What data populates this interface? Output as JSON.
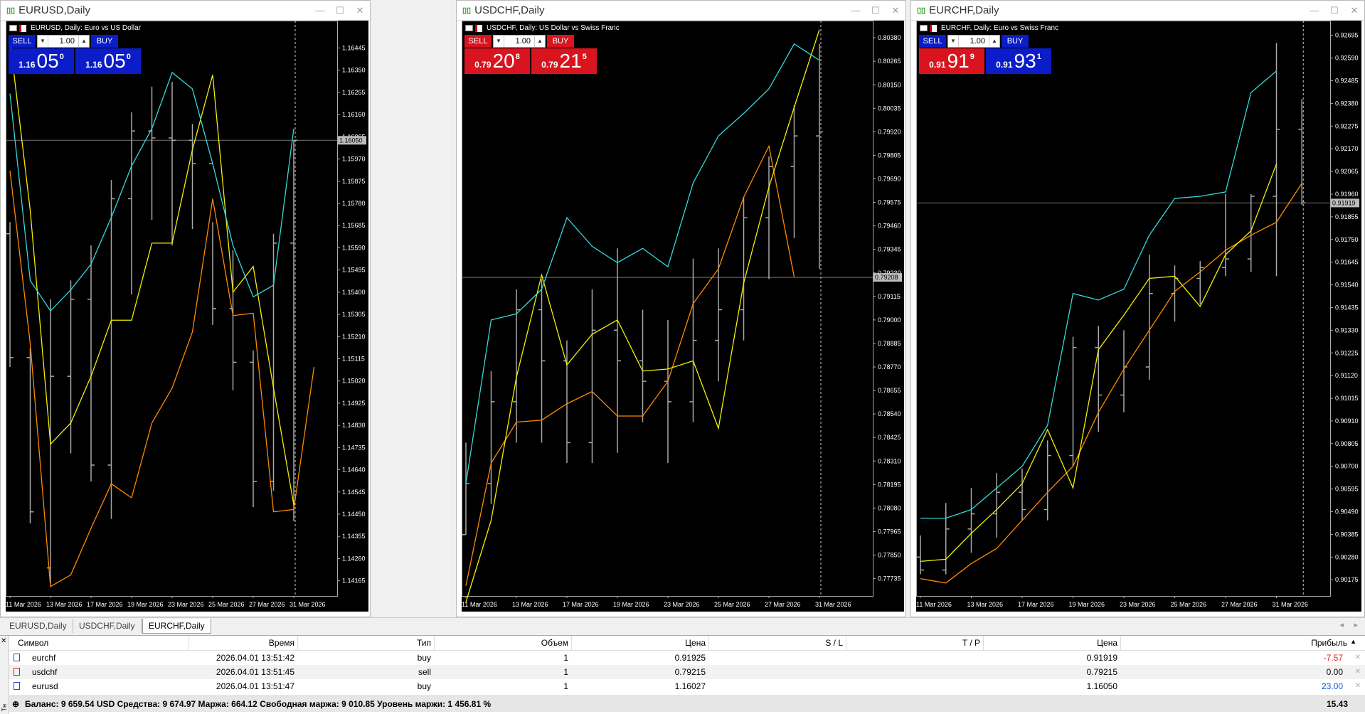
{
  "colors": {
    "bull": "#0b1cc9",
    "bear": "#d9141e",
    "cyan": "#33dada",
    "yellow": "#f5f000",
    "orange": "#ff8a00",
    "bar": "#a8a8a8"
  },
  "charts": [
    {
      "title": "EURUSD,Daily",
      "header": "EURUSD, Daily:  Euro vs US Dollar",
      "sell_label": "SELL",
      "buy_label": "BUY",
      "volume": "1.00",
      "sell_price": {
        "small": "1.16",
        "big": "05",
        "sup": "0"
      },
      "buy_price": {
        "small": "1.16",
        "big": "05",
        "sup": "0"
      },
      "price_ticks": [
        "1.16445",
        "1.16350",
        "1.16255",
        "1.16160",
        "1.16065",
        "1.15970",
        "1.15875",
        "1.15780",
        "1.15685",
        "1.15590",
        "1.15495",
        "1.15400",
        "1.15305",
        "1.15210",
        "1.15115",
        "1.15020",
        "1.14925",
        "1.14830",
        "1.14735",
        "1.14640",
        "1.14545",
        "1.14450",
        "1.14355",
        "1.14260",
        "1.14165"
      ],
      "current_price": "1.16050",
      "date_ticks": [
        "11 Mar 2026",
        "13 Mar 2026",
        "17 Mar 2026",
        "19 Mar 2026",
        "23 Mar 2026",
        "25 Mar 2026",
        "27 Mar 2026",
        "31 Mar 2026"
      ]
    },
    {
      "title": "USDCHF,Daily",
      "header": "USDCHF, Daily:  US Dollar vs Swiss Franc",
      "sell_label": "SELL",
      "buy_label": "BUY",
      "volume": "1.00",
      "sell_price": {
        "small": "0.79",
        "big": "20",
        "sup": "8"
      },
      "buy_price": {
        "small": "0.79",
        "big": "21",
        "sup": "5"
      },
      "price_ticks": [
        "0.80380",
        "0.80265",
        "0.80150",
        "0.80035",
        "0.79920",
        "0.79805",
        "0.79690",
        "0.79575",
        "0.79460",
        "0.79345",
        "0.79230",
        "0.79115",
        "0.79000",
        "0.78885",
        "0.78770",
        "0.78655",
        "0.78540",
        "0.78425",
        "0.78310",
        "0.78195",
        "0.78080",
        "0.77965",
        "0.77850",
        "0.77735"
      ],
      "current_price": "0.79208",
      "date_ticks": [
        "11 Mar 2026",
        "13 Mar 2026",
        "17 Mar 2026",
        "19 Mar 2026",
        "23 Mar 2026",
        "25 Mar 2026",
        "27 Mar 2026",
        "31 Mar 2026"
      ]
    },
    {
      "title": "EURCHF,Daily",
      "header": "EURCHF, Daily:  Euro vs Swiss Franc",
      "sell_label": "SELL",
      "buy_label": "BUY",
      "volume": "1.00",
      "sell_price": {
        "small": "0.91",
        "big": "91",
        "sup": "9"
      },
      "buy_price": {
        "small": "0.91",
        "big": "93",
        "sup": "1"
      },
      "price_ticks": [
        "0.92695",
        "0.92590",
        "0.92485",
        "0.92380",
        "0.92275",
        "0.92170",
        "0.92065",
        "0.91960",
        "0.91855",
        "0.91750",
        "0.91645",
        "0.91540",
        "0.91435",
        "0.91330",
        "0.91225",
        "0.91120",
        "0.91015",
        "0.90910",
        "0.90805",
        "0.90700",
        "0.90595",
        "0.90490",
        "0.90385",
        "0.90280",
        "0.90175"
      ],
      "current_price": "0.91919",
      "date_ticks": [
        "11 Mar 2026",
        "13 Mar 2026",
        "17 Mar 2026",
        "19 Mar 2026",
        "23 Mar 2026",
        "25 Mar 2026",
        "27 Mar 2026",
        "31 Mar 2026"
      ]
    }
  ],
  "tabs": [
    "EURUSD,Daily",
    "USDCHF,Daily",
    "EURCHF,Daily"
  ],
  "terminal": {
    "columns": [
      "Символ",
      "Время",
      "Тип",
      "Объем",
      "Цена",
      "S / L",
      "T / P",
      "Цена",
      "Прибыль"
    ],
    "rows": [
      {
        "symbol": "eurchf",
        "time": "2026.04.01 13:51:42",
        "type": "buy",
        "volume": "1",
        "price": "0.91925",
        "sl": "",
        "tp": "",
        "cur": "0.91919",
        "profit": "-7.57",
        "pcolor": "#e02020"
      },
      {
        "symbol": "usdchf",
        "time": "2026.04.01 13:51:45",
        "type": "sell",
        "volume": "1",
        "price": "0.79215",
        "sl": "",
        "tp": "",
        "cur": "0.79215",
        "profit": "0.00",
        "pcolor": "#000000"
      },
      {
        "symbol": "eurusd",
        "time": "2026.04.01 13:51:47",
        "type": "buy",
        "volume": "1",
        "price": "1.16027",
        "sl": "",
        "tp": "",
        "cur": "1.16050",
        "profit": "23.00",
        "pcolor": "#1a4fd8"
      }
    ],
    "summary": "Баланс: 9 659.54 USD  Средства: 9 674.97  Маржа: 664.12  Свободная маржа: 9 010.85  Уровень маржи: 1 456.81 %",
    "total": "15.43",
    "side_label": "Тн"
  },
  "chart_data": [
    {
      "type": "bar",
      "symbol": "EURUSD",
      "ylim": [
        1.141,
        1.1655
      ],
      "bars": [
        [
          1.1565,
          1.157,
          1.1508,
          1.1512
        ],
        [
          1.1512,
          1.1516,
          1.1441,
          1.1446
        ],
        [
          1.1422,
          1.1537,
          1.1415,
          1.1504
        ],
        [
          1.1504,
          1.1545,
          1.1471,
          1.1537
        ],
        [
          1.1537,
          1.156,
          1.1459,
          1.1466
        ],
        [
          1.1466,
          1.1588,
          1.1443,
          1.158
        ],
        [
          1.158,
          1.1617,
          1.1539,
          1.1609
        ],
        [
          1.1609,
          1.1628,
          1.1571,
          1.1606
        ],
        [
          1.1606,
          1.163,
          1.156,
          1.1605
        ],
        [
          1.1605,
          1.1612,
          1.1567,
          1.1595
        ],
        [
          1.1595,
          1.157,
          1.1526,
          1.1533
        ],
        [
          1.1533,
          1.1558,
          1.1498,
          1.151
        ],
        [
          1.151,
          1.1515,
          1.1448,
          1.1459
        ],
        [
          1.1459,
          1.1565,
          1.1455,
          1.1561
        ],
        [
          1.1561,
          1.1605,
          1.1442,
          1.1605
        ]
      ],
      "ma_cyan": [
        1.1625,
        1.1545,
        1.1532,
        1.1541,
        1.1552,
        1.1572,
        1.1594,
        1.161,
        1.1634,
        1.1627,
        1.1595,
        1.156,
        1.1538,
        1.1543,
        1.161
      ],
      "ma_yellow": [
        1.1648,
        1.1575,
        1.1475,
        1.1484,
        1.1504,
        1.1528,
        1.1528,
        1.1561,
        1.1561,
        1.1601,
        1.1633,
        1.154,
        1.1551,
        1.1499,
        1.1449
      ],
      "ma_orange": [
        1.1592,
        1.1518,
        1.1414,
        1.1419,
        1.1439,
        1.1458,
        1.1452,
        1.1484,
        1.1499,
        1.1523,
        1.158,
        1.153,
        1.1531,
        1.1446,
        1.1447,
        1.1508
      ]
    },
    {
      "type": "bar",
      "symbol": "USDCHF",
      "ylim": [
        0.7765,
        0.8045
      ],
      "bars": [
        [
          0.7795,
          0.784,
          0.7795,
          0.782
        ],
        [
          0.782,
          0.7875,
          0.781,
          0.786
        ],
        [
          0.786,
          0.7915,
          0.784,
          0.7905
        ],
        [
          0.7905,
          0.792,
          0.784,
          0.788
        ],
        [
          0.788,
          0.789,
          0.783,
          0.784
        ],
        [
          0.784,
          0.7915,
          0.783,
          0.7895
        ],
        [
          0.7895,
          0.7935,
          0.7835,
          0.788
        ],
        [
          0.788,
          0.7905,
          0.785,
          0.787
        ],
        [
          0.787,
          0.79,
          0.783,
          0.786
        ],
        [
          0.786,
          0.793,
          0.785,
          0.789
        ],
        [
          0.789,
          0.7935,
          0.787,
          0.7905
        ],
        [
          0.7905,
          0.796,
          0.789,
          0.795
        ],
        [
          0.795,
          0.798,
          0.792,
          0.7975
        ],
        [
          0.7975,
          0.8005,
          0.794,
          0.799
        ],
        [
          0.799,
          0.8035,
          0.7925,
          0.7992
        ]
      ],
      "ma_cyan": [
        0.782,
        0.79,
        0.7903,
        0.7915,
        0.795,
        0.7936,
        0.7928,
        0.7935,
        0.7926,
        0.7967,
        0.799,
        0.8001,
        0.8013,
        0.8035,
        0.8027
      ],
      "ma_yellow": [
        0.7762,
        0.7802,
        0.7872,
        0.7922,
        0.7878,
        0.7893,
        0.79,
        0.7875,
        0.7876,
        0.788,
        0.7847,
        0.7918,
        0.7965,
        0.8004,
        0.8042
      ],
      "ma_orange": [
        0.777,
        0.783,
        0.785,
        0.7851,
        0.7859,
        0.7865,
        0.7853,
        0.7853,
        0.787,
        0.7908,
        0.7925,
        0.796,
        0.7985,
        0.7921
      ]
    },
    {
      "type": "bar",
      "symbol": "EURCHF",
      "ylim": [
        0.901,
        0.9275
      ],
      "bars": [
        [
          0.9028,
          0.9038,
          0.902,
          0.9022
        ],
        [
          0.9022,
          0.9053,
          0.902,
          0.9041
        ],
        [
          0.9041,
          0.906,
          0.903,
          0.9048
        ],
        [
          0.9048,
          0.9067,
          0.9037,
          0.9058
        ],
        [
          0.9058,
          0.9069,
          0.9045,
          0.905
        ],
        [
          0.905,
          0.9082,
          0.9045,
          0.9075
        ],
        [
          0.9075,
          0.913,
          0.907,
          0.9125
        ],
        [
          0.9125,
          0.9135,
          0.9086,
          0.9103
        ],
        [
          0.9103,
          0.9133,
          0.9095,
          0.9116
        ],
        [
          0.9116,
          0.9168,
          0.911,
          0.915
        ],
        [
          0.915,
          0.9163,
          0.9137,
          0.9157
        ],
        [
          0.9157,
          0.9165,
          0.9145,
          0.9162
        ],
        [
          0.9162,
          0.9196,
          0.9158,
          0.9166
        ],
        [
          0.9166,
          0.9196,
          0.916,
          0.9195
        ],
        [
          0.9195,
          0.9266,
          0.9158,
          0.9226
        ],
        [
          0.9226,
          0.924,
          0.9191,
          0.9192
        ]
      ],
      "ma_cyan": [
        0.9046,
        0.9046,
        0.905,
        0.906,
        0.907,
        0.9089,
        0.915,
        0.9147,
        0.9152,
        0.9177,
        0.9194,
        0.9195,
        0.9197,
        0.9243,
        0.9253
      ],
      "ma_yellow": [
        0.9026,
        0.9027,
        0.9039,
        0.905,
        0.9062,
        0.9087,
        0.906,
        0.9124,
        0.914,
        0.9157,
        0.9158,
        0.9144,
        0.9168,
        0.9179,
        0.921
      ],
      "ma_orange": [
        0.9018,
        0.9016,
        0.9025,
        0.9032,
        0.9045,
        0.9058,
        0.907,
        0.9095,
        0.9115,
        0.9133,
        0.9151,
        0.916,
        0.917,
        0.9177,
        0.9183,
        0.9201
      ]
    }
  ]
}
